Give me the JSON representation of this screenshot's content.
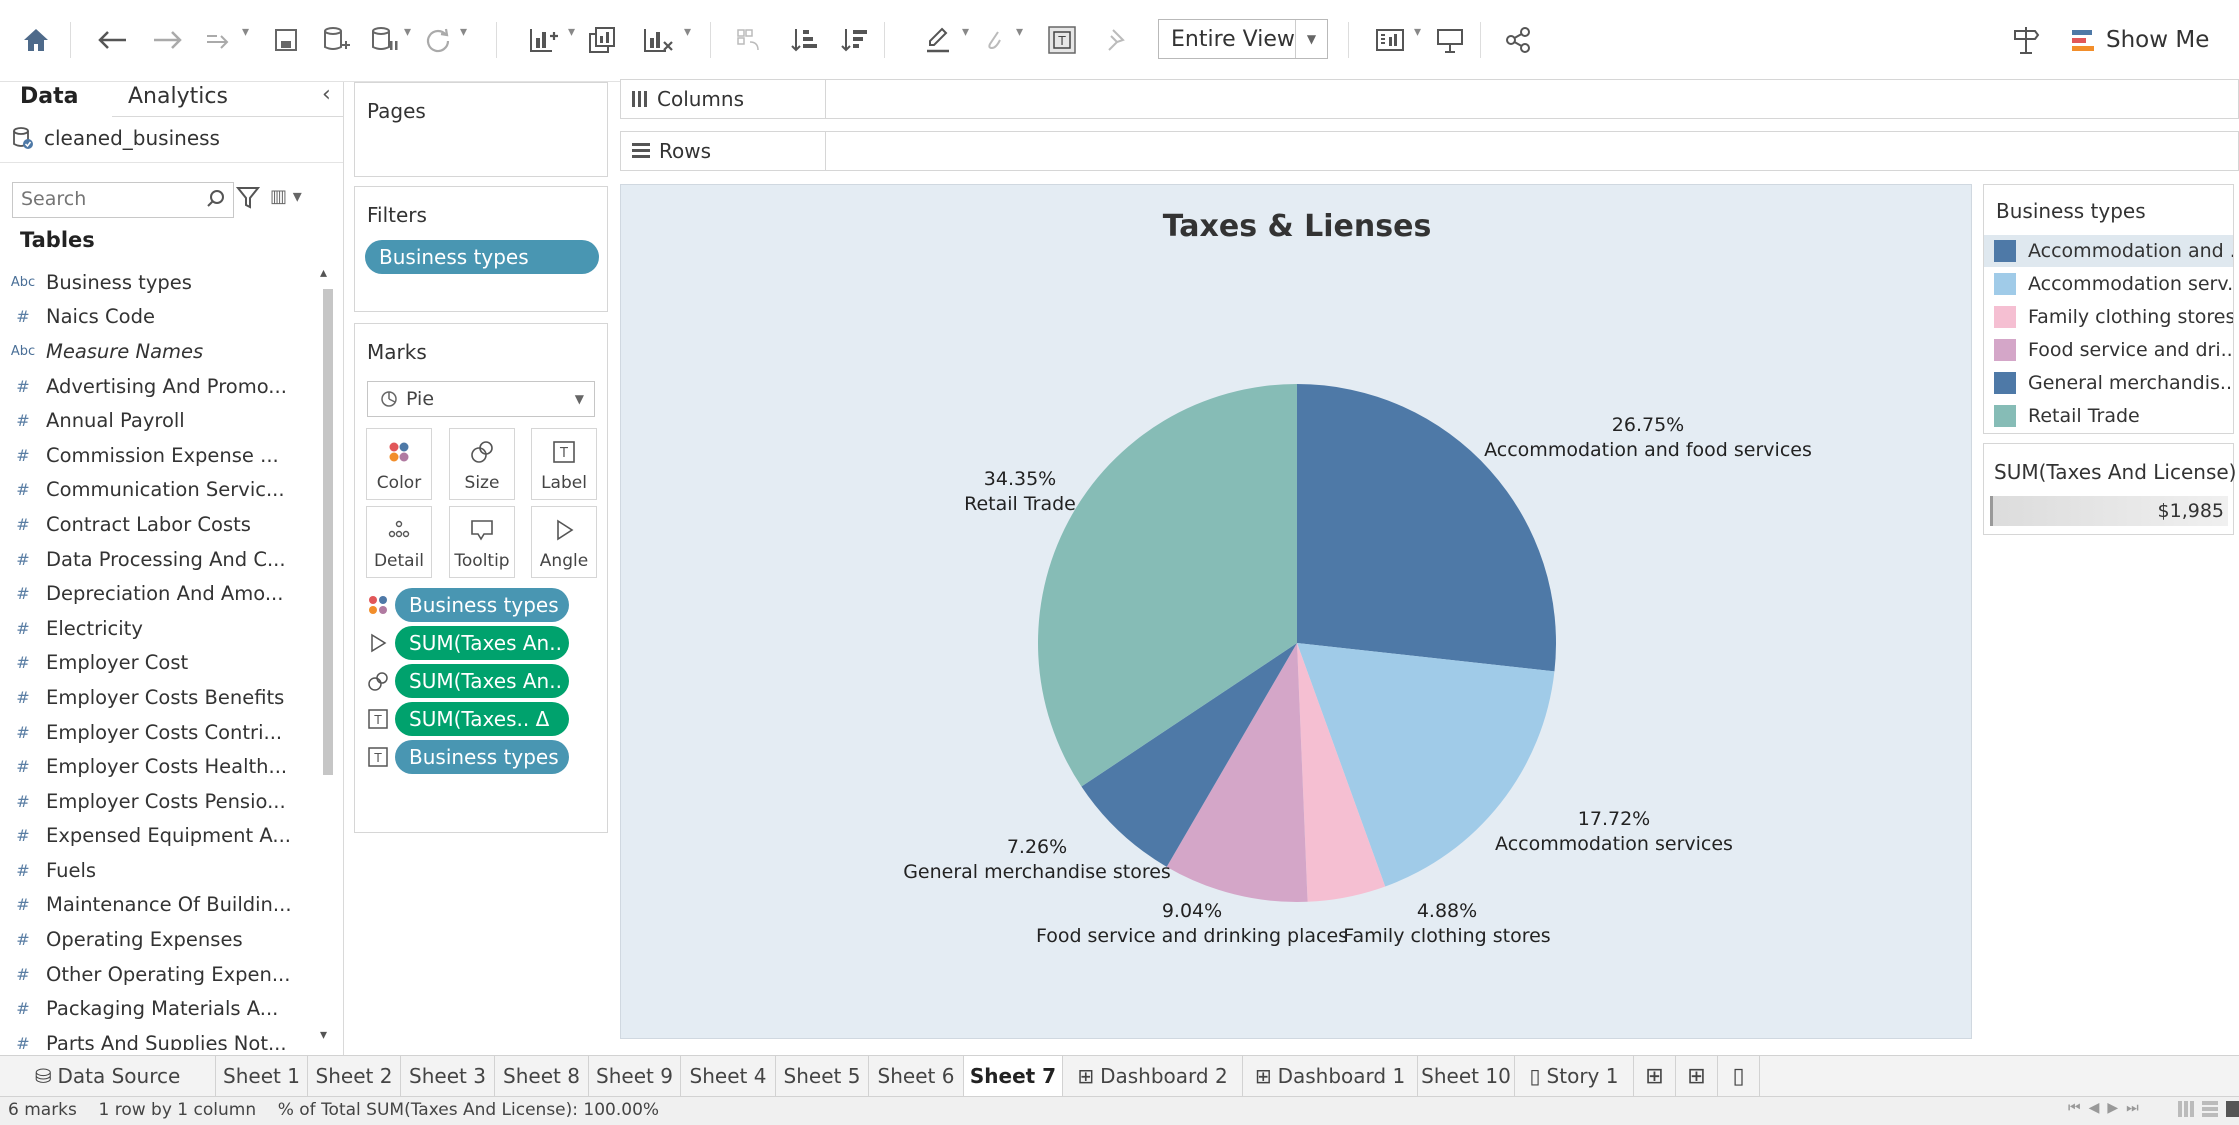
{
  "toolbar": {
    "fit_value": "Entire View",
    "show_me_label": "Show Me"
  },
  "data_pane": {
    "tab_data": "Data",
    "tab_analytics": "Analytics",
    "datasource": "cleaned_business",
    "search_placeholder": "Search",
    "tables_header": "Tables",
    "fields": [
      {
        "type": "Abc",
        "name": "Business types",
        "italic": false
      },
      {
        "type": "#",
        "name": "Naics Code",
        "italic": false
      },
      {
        "type": "Abc",
        "name": "Measure Names",
        "italic": true
      },
      {
        "type": "#",
        "name": "Advertising And Promo...",
        "italic": false
      },
      {
        "type": "#",
        "name": "Annual Payroll",
        "italic": false
      },
      {
        "type": "#",
        "name": "Commission Expense ...",
        "italic": false
      },
      {
        "type": "#",
        "name": "Communication Servic...",
        "italic": false
      },
      {
        "type": "#",
        "name": "Contract Labor Costs",
        "italic": false
      },
      {
        "type": "#",
        "name": "Data Processing And C...",
        "italic": false
      },
      {
        "type": "#",
        "name": "Depreciation And Amo...",
        "italic": false
      },
      {
        "type": "#",
        "name": "Electricity",
        "italic": false
      },
      {
        "type": "#",
        "name": "Employer Cost",
        "italic": false
      },
      {
        "type": "#",
        "name": "Employer Costs Benefits",
        "italic": false
      },
      {
        "type": "#",
        "name": "Employer Costs Contri...",
        "italic": false
      },
      {
        "type": "#",
        "name": "Employer Costs Health...",
        "italic": false
      },
      {
        "type": "#",
        "name": "Employer Costs Pensio...",
        "italic": false
      },
      {
        "type": "#",
        "name": "Expensed Equipment A...",
        "italic": false
      },
      {
        "type": "#",
        "name": "Fuels",
        "italic": false
      },
      {
        "type": "#",
        "name": "Maintenance Of Buildin...",
        "italic": false
      },
      {
        "type": "#",
        "name": "Operating Expenses",
        "italic": false
      },
      {
        "type": "#",
        "name": "Other Operating Expen...",
        "italic": false
      },
      {
        "type": "#",
        "name": "Packaging Materials A...",
        "italic": false
      },
      {
        "type": "#",
        "name": "Parts And Supplies Not...",
        "italic": false
      }
    ]
  },
  "cards": {
    "pages_title": "Pages",
    "filters_title": "Filters",
    "filter_pill": "Business types",
    "marks_title": "Marks",
    "mark_type": "Pie",
    "mark_buttons": [
      "Color",
      "Size",
      "Label",
      "Detail",
      "Tooltip",
      "Angle"
    ],
    "encodings": [
      {
        "icon": "color",
        "label": "Business types",
        "kind": "dim"
      },
      {
        "icon": "angle",
        "label": "SUM(Taxes An..",
        "kind": "meas"
      },
      {
        "icon": "size",
        "label": "SUM(Taxes An..",
        "kind": "meas"
      },
      {
        "icon": "label",
        "label": "SUM(Taxes.. Δ",
        "kind": "meas"
      },
      {
        "icon": "label",
        "label": "Business types",
        "kind": "dim"
      }
    ]
  },
  "shelves": {
    "columns_label": "Columns",
    "rows_label": "Rows"
  },
  "chart_data": {
    "type": "pie",
    "title": "Taxes & Lienses",
    "slices": [
      {
        "name": "Accommodation and food services",
        "percent": 26.75,
        "label": "26.75%",
        "color": "#4e79a7"
      },
      {
        "name": "Accommodation services",
        "percent": 17.72,
        "label": "17.72%",
        "color": "#a0cbe8"
      },
      {
        "name": "Family clothing stores",
        "percent": 4.88,
        "label": "4.88%",
        "color": "#f5bfd2"
      },
      {
        "name": "Food service and drinking places",
        "percent": 9.04,
        "label": "9.04%",
        "color": "#d4a6c8"
      },
      {
        "name": "General merchandise stores",
        "percent": 7.26,
        "label": "7.26%",
        "color": "#4e79a7"
      },
      {
        "name": "Retail Trade",
        "percent": 34.35,
        "label": "34.35%",
        "color": "#86bcb6"
      }
    ]
  },
  "legend": {
    "title": "Business types",
    "items": [
      {
        "label": "Accommodation and ..",
        "color": "#4e79a7"
      },
      {
        "label": "Accommodation serv..",
        "color": "#a0cbe8"
      },
      {
        "label": "Family clothing stores",
        "color": "#f5bfd2"
      },
      {
        "label": "Food service and dri..",
        "color": "#d4a6c8"
      },
      {
        "label": "General merchandis..",
        "color": "#4e79a7"
      },
      {
        "label": "Retail Trade",
        "color": "#86bcb6"
      }
    ]
  },
  "size_legend": {
    "title": "SUM(Taxes And License)",
    "value": "$1,985"
  },
  "sheet_tabs": [
    {
      "label": "Data Source",
      "icon": "datasource",
      "active": false
    },
    {
      "label": "Sheet 1",
      "active": false
    },
    {
      "label": "Sheet 2",
      "active": false
    },
    {
      "label": "Sheet 3",
      "active": false
    },
    {
      "label": "Sheet 8",
      "active": false
    },
    {
      "label": "Sheet 9",
      "active": false
    },
    {
      "label": "Sheet 4",
      "active": false
    },
    {
      "label": "Sheet 5",
      "active": false
    },
    {
      "label": "Sheet 6",
      "active": false
    },
    {
      "label": "Sheet 7",
      "active": true
    },
    {
      "label": "Dashboard 2",
      "icon": "dashboard",
      "active": false
    },
    {
      "label": "Dashboard 1",
      "icon": "dashboard",
      "active": false
    },
    {
      "label": "Sheet 10",
      "active": false
    },
    {
      "label": "Story 1",
      "icon": "story",
      "active": false
    }
  ],
  "status": {
    "text": "6 marks    1 row by 1 column    % of Total SUM(Taxes And License): 100.00%"
  }
}
